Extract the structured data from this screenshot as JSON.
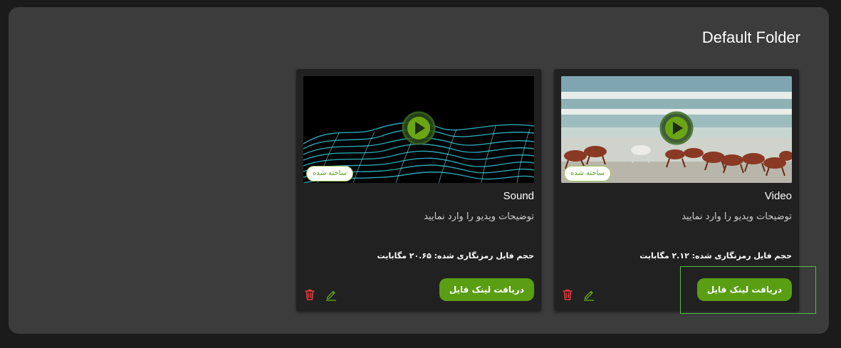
{
  "folder": {
    "title": "Default Folder"
  },
  "cards": [
    {
      "title": "Video",
      "description": "توضیحات ویدیو را وارد نمایید",
      "size_text": "حجم فایل رمزنگاری شده: ۲.۱۲ مگابایت",
      "badge": "ساخته شده",
      "link_label": "دریافت لینک فایل",
      "thumbnail": "horses-running-on-beach"
    },
    {
      "title": "Sound",
      "description": "توضیحات ویدیو را وارد نمایید",
      "size_text": "حجم فایل رمزنگاری شده: ۲۰.۶۵ مگابایت",
      "badge": "ساخته شده",
      "link_label": "دریافت لینک فایل",
      "thumbnail": "cyan-wave-mesh"
    }
  ],
  "icons": {
    "play": "play-icon",
    "trash": "trash-icon",
    "edit": "pencil-icon"
  },
  "colors": {
    "accent": "#5a9e14",
    "danger": "#e23b3b",
    "badge_text": "#5aa21a",
    "panel": "#3c3c3c"
  }
}
